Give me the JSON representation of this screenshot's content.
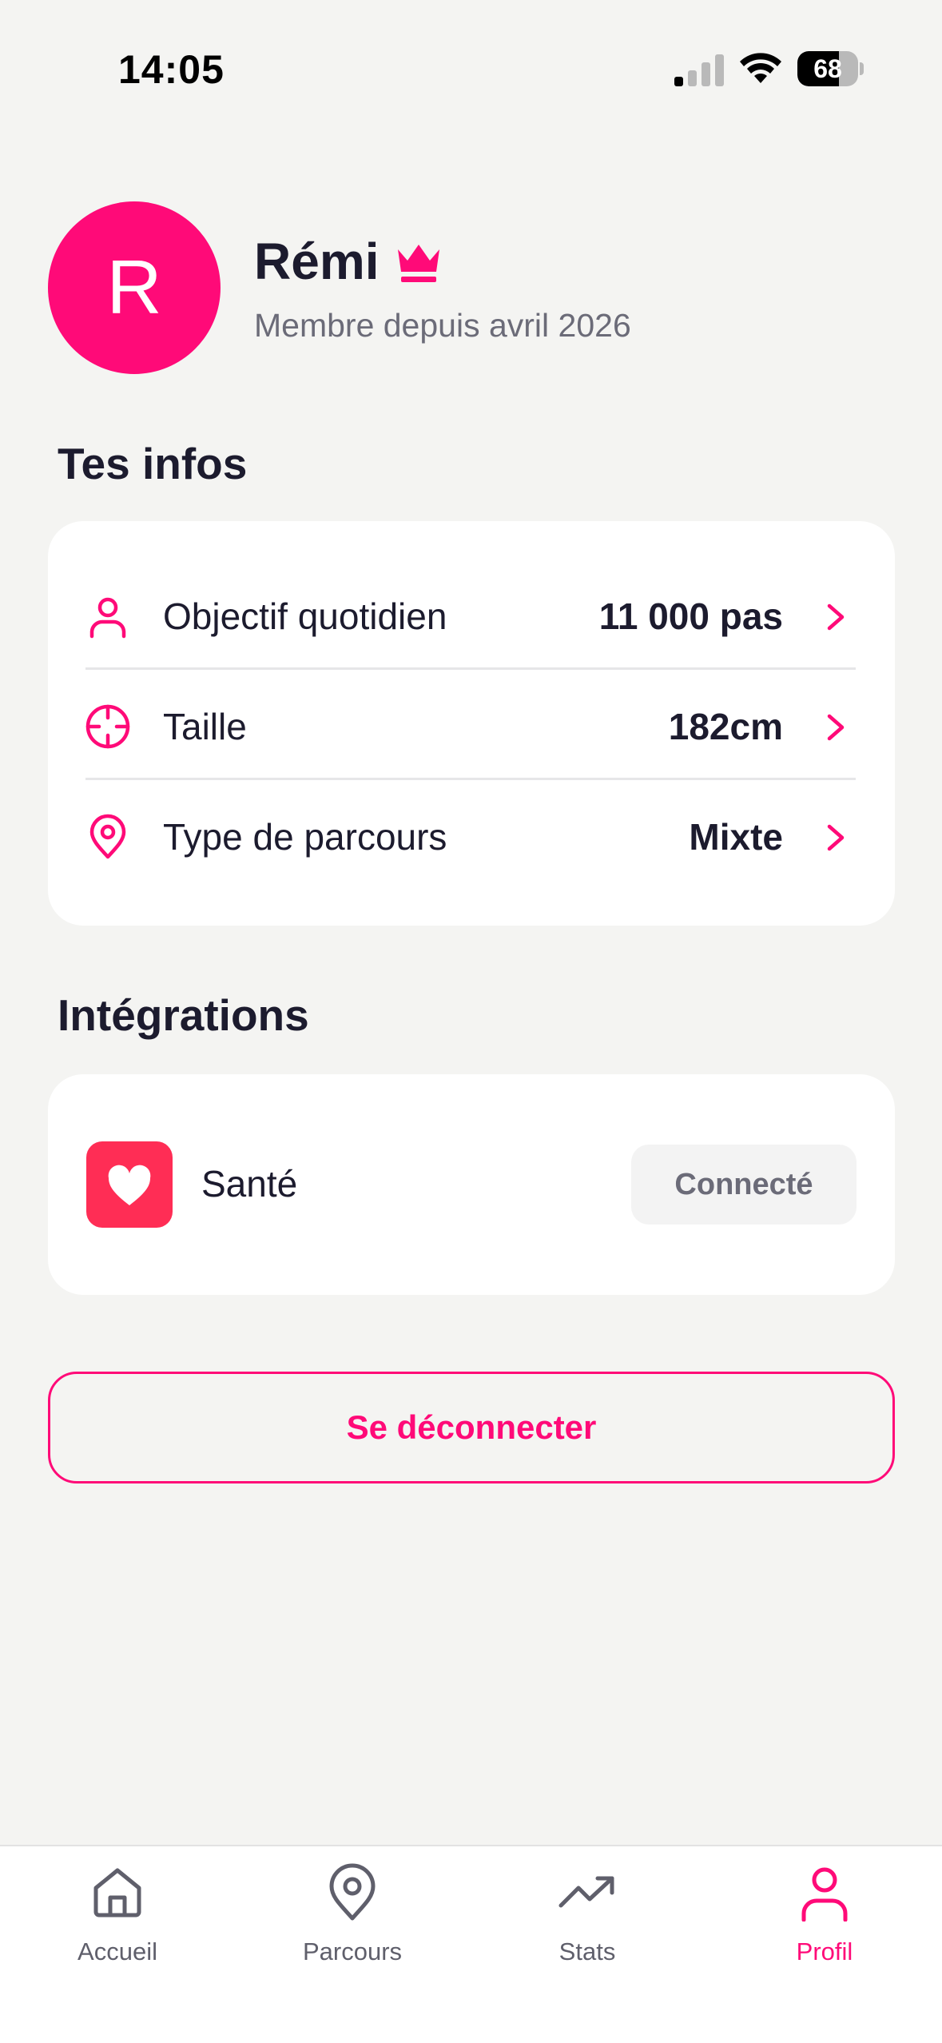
{
  "status_bar": {
    "time": "14:05",
    "battery_percent": "68",
    "battery_level": 0.68
  },
  "profile": {
    "initial": "R",
    "name": "Rémi",
    "badge_icon": "crown-icon",
    "member_since": "Membre depuis avril 2026"
  },
  "info_section": {
    "title": "Tes infos",
    "rows": [
      {
        "icon": "user-icon",
        "label": "Objectif quotidien",
        "value": "11 000 pas"
      },
      {
        "icon": "crosshair-icon",
        "label": "Taille",
        "value": "182cm"
      },
      {
        "icon": "map-pin-icon",
        "label": "Type de parcours",
        "value": "Mixte"
      }
    ]
  },
  "integrations_section": {
    "title": "Intégrations",
    "items": [
      {
        "icon": "heart-icon",
        "label": "Santé",
        "status": "Connecté"
      }
    ]
  },
  "logout_label": "Se déconnecter",
  "tab_bar": {
    "active": "Profil",
    "tabs": [
      {
        "icon": "home-icon",
        "label": "Accueil"
      },
      {
        "icon": "map-pin-icon",
        "label": "Parcours"
      },
      {
        "icon": "trending-up-icon",
        "label": "Stats"
      },
      {
        "icon": "user-icon",
        "label": "Profil"
      }
    ]
  },
  "colors": {
    "accent": "#FF0A78",
    "health_red": "#FF2D55",
    "background": "#F4F4F2",
    "text_primary": "#1C1B2E",
    "text_secondary": "#6B6B78"
  }
}
